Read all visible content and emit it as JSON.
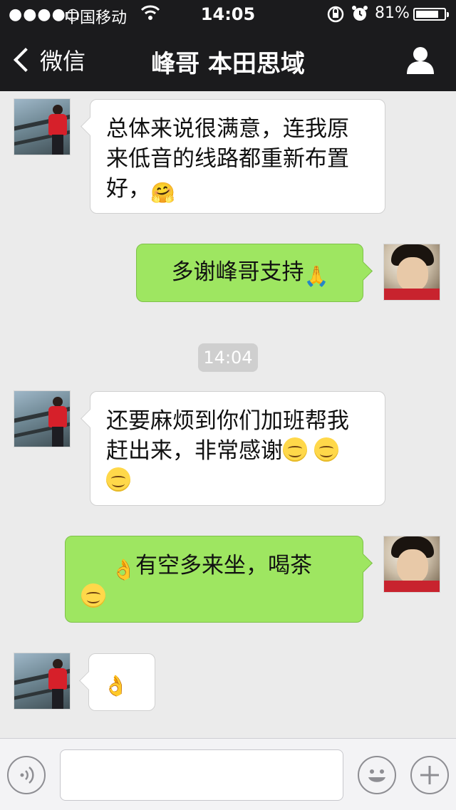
{
  "status_bar": {
    "signal": "●●●●○",
    "carrier": "中国移动",
    "time": "14:05",
    "battery_percent": "81%",
    "battery_level": 0.81,
    "icons": [
      "wifi-icon",
      "orientation-lock-icon",
      "alarm-icon",
      "battery-icon"
    ]
  },
  "nav": {
    "back_label": "微信",
    "title": "峰哥 本田思域",
    "profile_icon": "person-icon"
  },
  "messages": [
    {
      "side": "left",
      "text": "总体来说很满意，连我原来低音的线路都重新布置好，",
      "emoji": "hugging-face"
    },
    {
      "side": "right",
      "text": "多谢峰哥支持",
      "emoji": "praying-hands"
    },
    {
      "side": "left",
      "text": "还要麻烦到你们加班帮我赶出来，非常感谢",
      "emoji": "smiling-face x3"
    },
    {
      "side": "right",
      "text": "有空多来坐，喝茶",
      "emoji": "ok-hand + smiling-face"
    },
    {
      "side": "left",
      "text": "",
      "emoji": "ok-hand"
    }
  ],
  "timestamp": "14:04",
  "input_bar": {
    "voice_icon": "voice-icon",
    "emoji_icon": "emoji-icon",
    "plus_icon": "plus-icon"
  },
  "colors": {
    "nav_bg": "#1b1b1d",
    "chat_bg": "#ebebeb",
    "sent_bubble": "#9ee661",
    "received_bubble": "#ffffff"
  }
}
